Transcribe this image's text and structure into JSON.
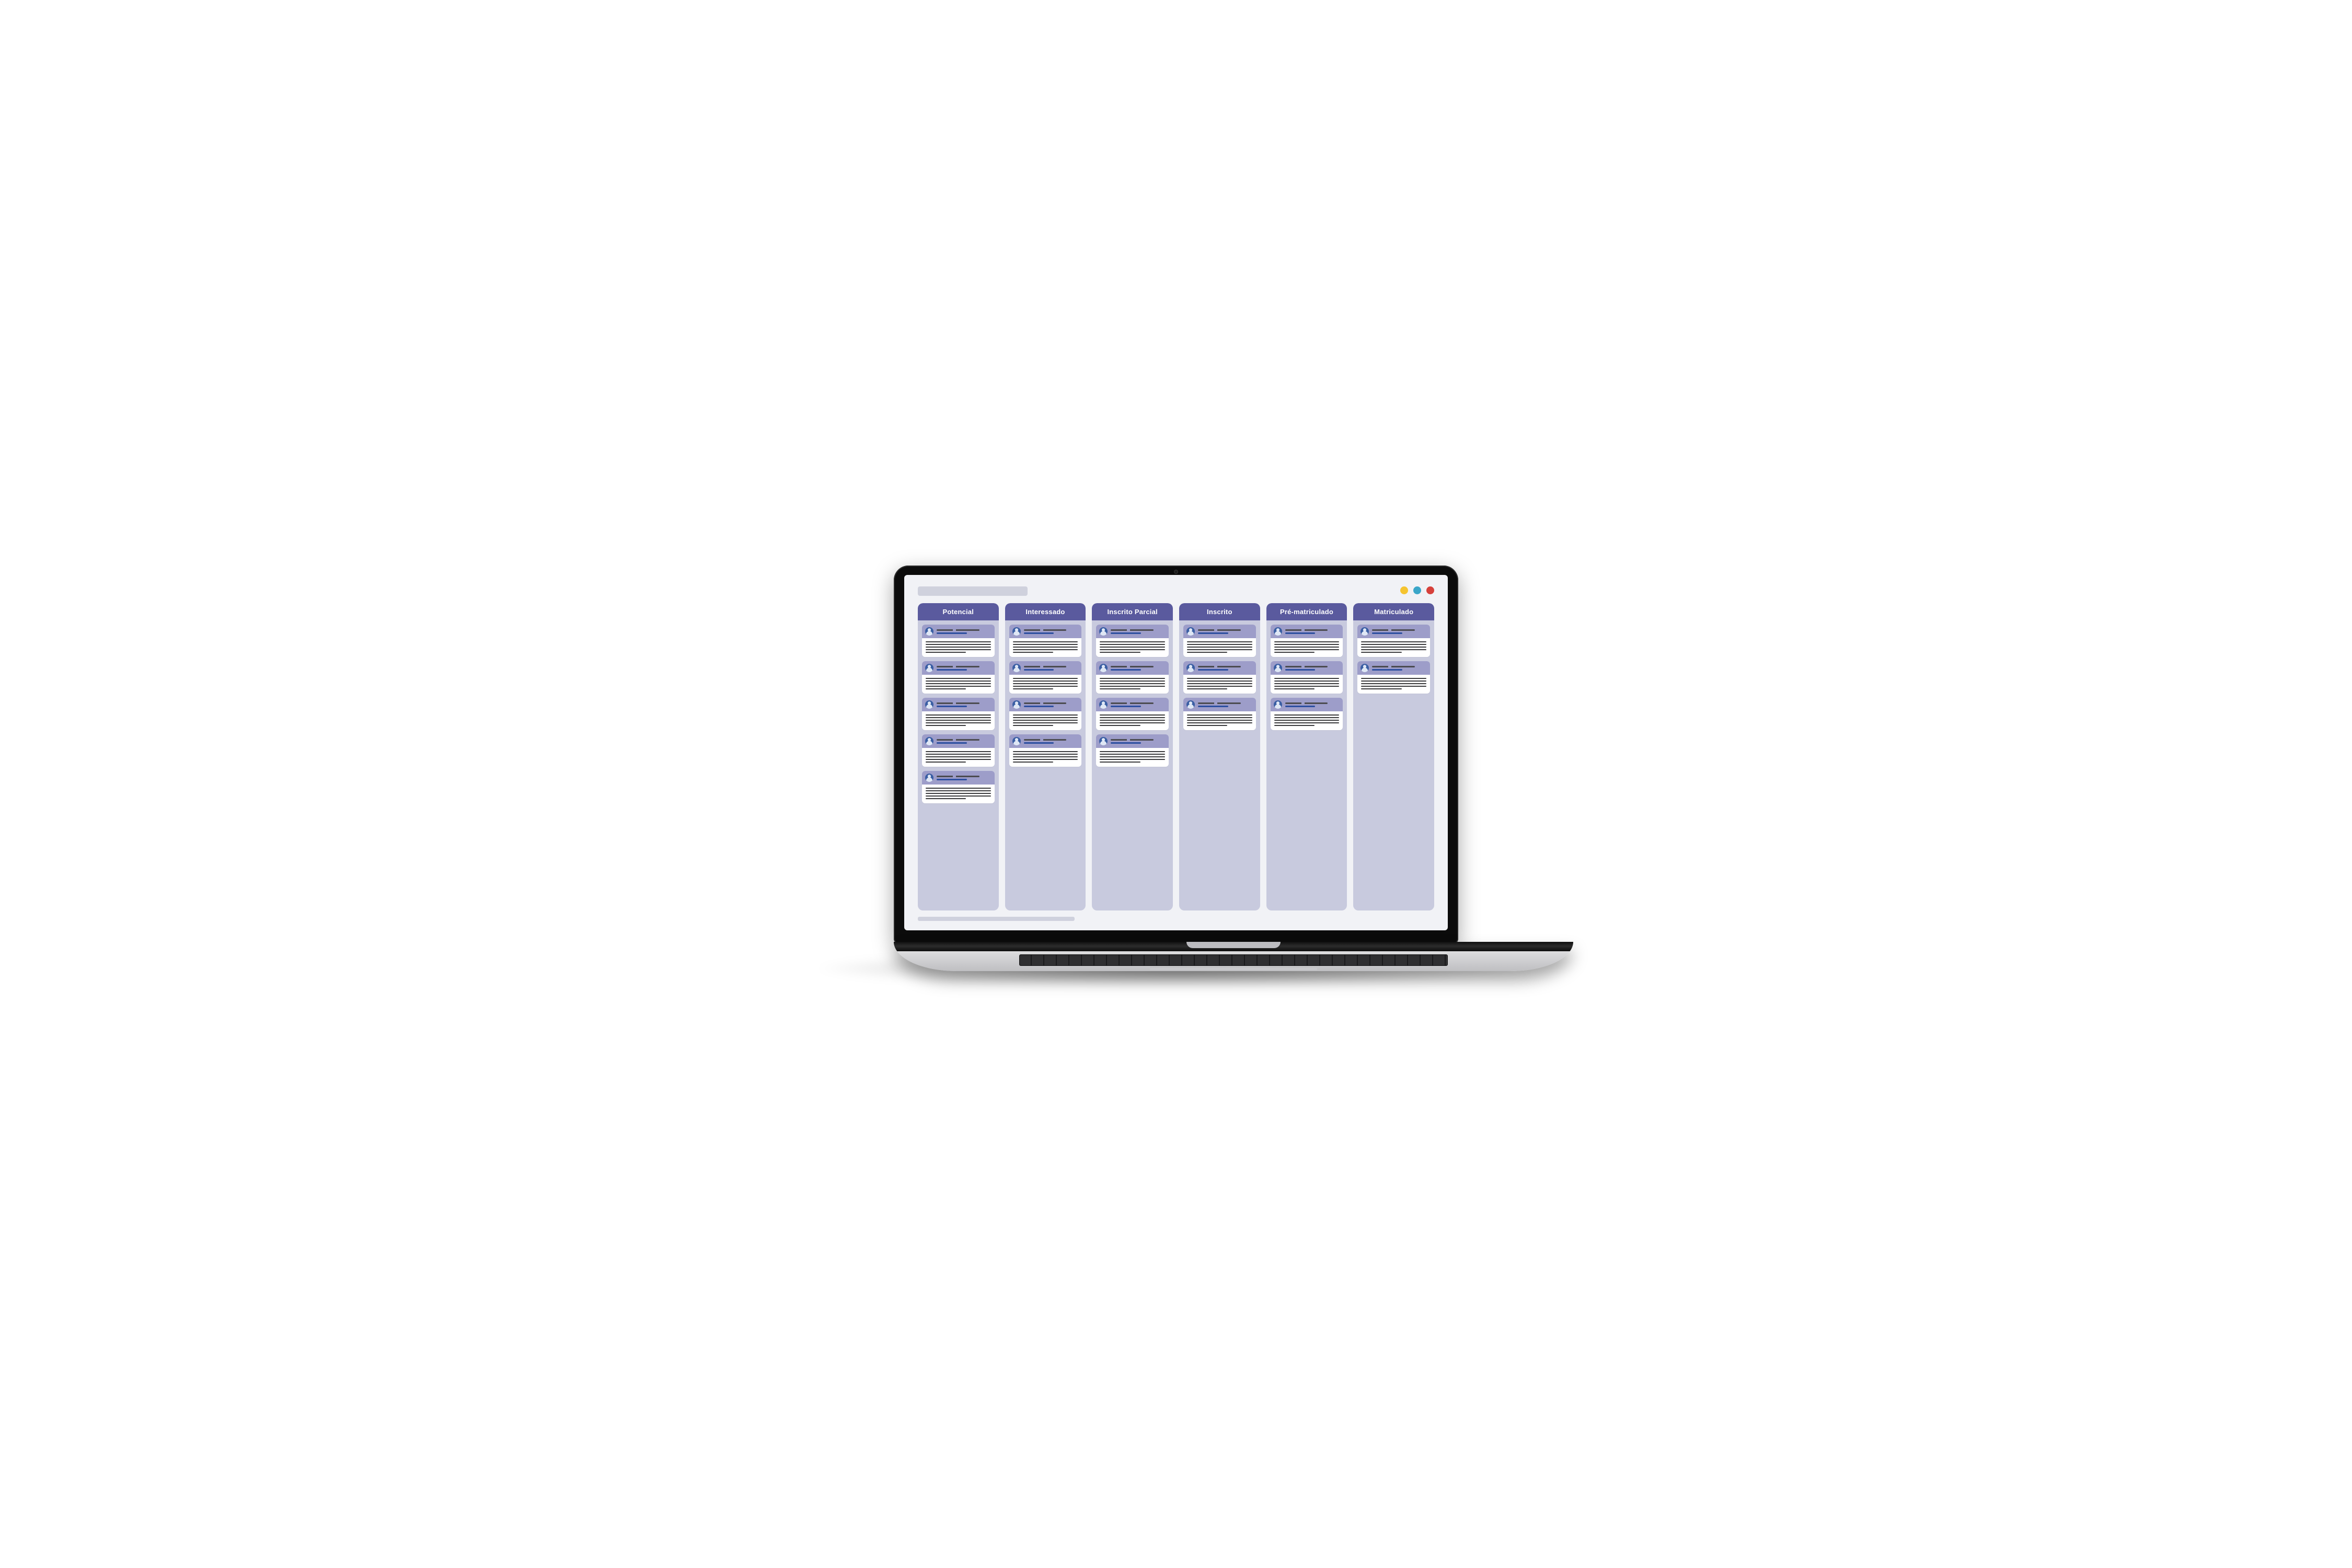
{
  "window_controls": {
    "dots": [
      {
        "name": "minimize",
        "color": "#f5c430"
      },
      {
        "name": "zoom",
        "color": "#3aa6c9"
      },
      {
        "name": "close",
        "color": "#d6403b"
      }
    ]
  },
  "board": {
    "columns": [
      {
        "id": "potencial",
        "title": "Potencial",
        "card_count": 5
      },
      {
        "id": "interessado",
        "title": "Interessado",
        "card_count": 4
      },
      {
        "id": "inscrito-parcial",
        "title": "Inscrito Parcial",
        "card_count": 4
      },
      {
        "id": "inscrito",
        "title": "Inscrito",
        "card_count": 3
      },
      {
        "id": "pre-matriculado",
        "title": "Pré-matriculado",
        "card_count": 3
      },
      {
        "id": "matriculado",
        "title": "Matriculado",
        "card_count": 2
      }
    ]
  },
  "colors": {
    "column_header": "#5a5a9e",
    "column_bg": "#c8cade",
    "card_head": "#9d9dc9",
    "avatar": "#3b5fa4"
  }
}
